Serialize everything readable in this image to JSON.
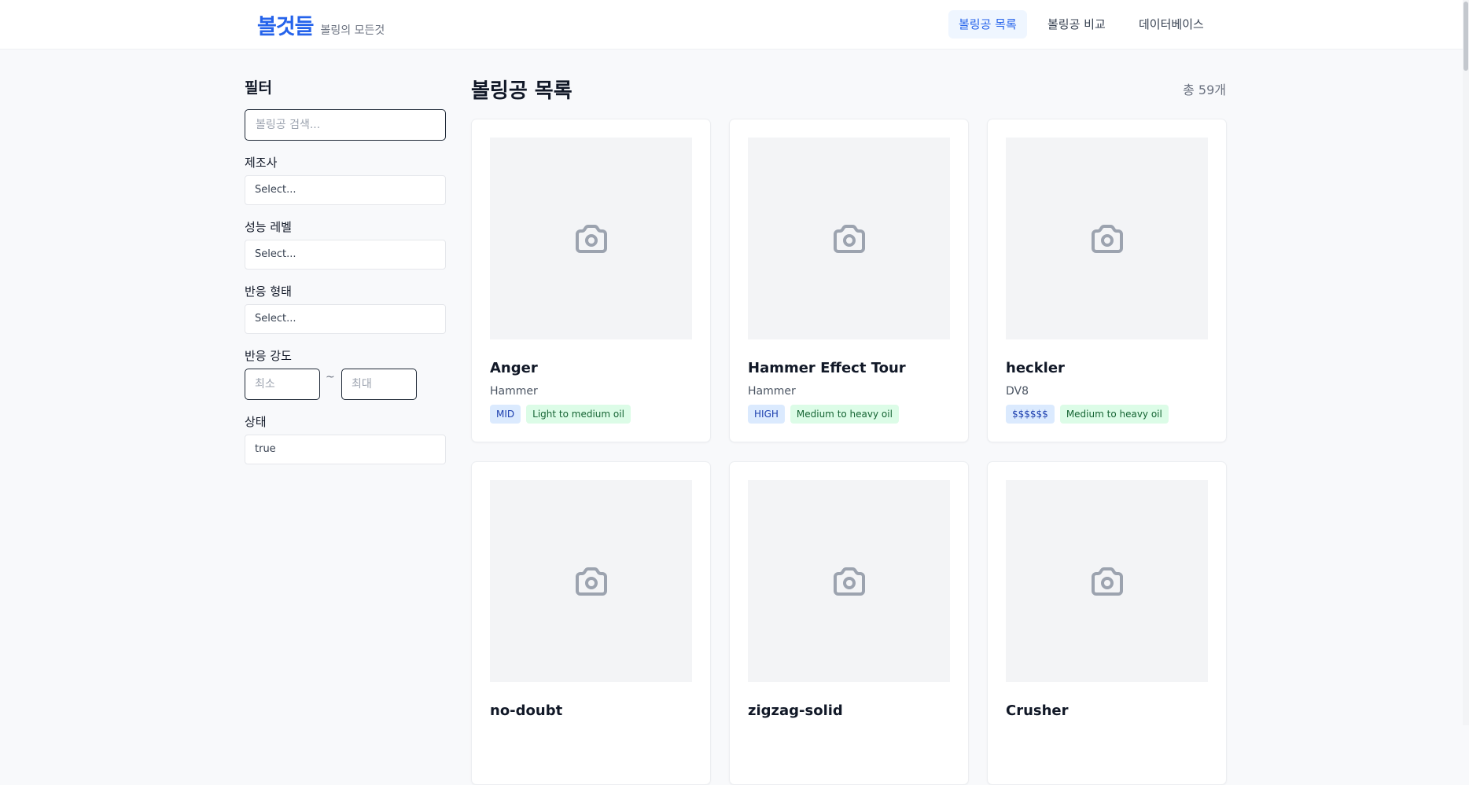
{
  "header": {
    "brand": "볼것들",
    "tagline": "볼링의 모든것",
    "nav": [
      {
        "label": "볼링공 목록",
        "active": true
      },
      {
        "label": "볼링공 비교",
        "active": false
      },
      {
        "label": "데이터베이스",
        "active": false
      }
    ]
  },
  "sidebar": {
    "title": "필터",
    "search_placeholder": "볼링공 검색...",
    "manufacturer": {
      "label": "제조사",
      "value": "Select..."
    },
    "performance": {
      "label": "성능 레벨",
      "value": "Select..."
    },
    "reaction_shape": {
      "label": "반응 형태",
      "value": "Select..."
    },
    "reaction_strength": {
      "label": "반응 강도",
      "min_placeholder": "최소",
      "max_placeholder": "최대",
      "separator": "~"
    },
    "status": {
      "label": "상태",
      "value": "true"
    }
  },
  "main": {
    "title": "볼링공 목록",
    "count": "총 59개",
    "cards": [
      {
        "name": "Anger",
        "brand": "Hammer",
        "tags": [
          "MID",
          "Light to medium oil"
        ]
      },
      {
        "name": "Hammer Effect Tour",
        "brand": "Hammer",
        "tags": [
          "HIGH",
          "Medium to heavy oil"
        ]
      },
      {
        "name": "heckler",
        "brand": "DV8",
        "tags": [
          "$$$$$$",
          "Medium to heavy oil"
        ]
      },
      {
        "name": "no-doubt",
        "brand": "",
        "tags": []
      },
      {
        "name": "zigzag-solid",
        "brand": "",
        "tags": []
      },
      {
        "name": "Crusher",
        "brand": "",
        "tags": []
      }
    ]
  },
  "icons": {
    "placeholder_image": "camera-icon"
  },
  "colors": {
    "brand": "#2563eb",
    "active_nav_bg": "#eff6ff",
    "tag_blue_bg": "#dbeafe",
    "tag_green_bg": "#dcfce7"
  }
}
